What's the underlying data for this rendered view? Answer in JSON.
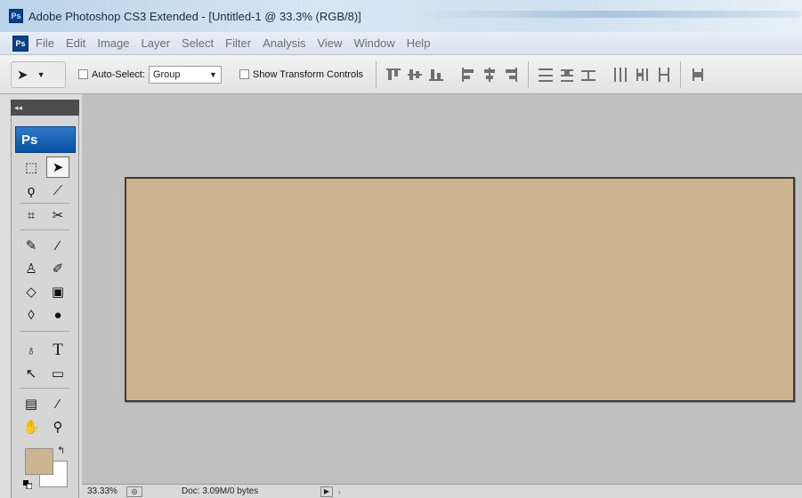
{
  "window": {
    "app_badge": "Ps",
    "title": "Adobe Photoshop CS3 Extended - [Untitled-1 @ 33.3% (RGB/8)]"
  },
  "menu": {
    "badge": "Ps",
    "items": [
      "File",
      "Edit",
      "Image",
      "Layer",
      "Select",
      "Filter",
      "Analysis",
      "View",
      "Window",
      "Help"
    ]
  },
  "options": {
    "tool_preset_icon": "move-tool-icon",
    "auto_select_label": "Auto-Select:",
    "auto_select_checked": false,
    "auto_select_value": "Group",
    "show_transform_label": "Show Transform Controls",
    "show_transform_checked": false
  },
  "toolbox": {
    "collapse_glyph": "◂◂",
    "logo": "Ps",
    "tools": [
      "rectangular-marquee-tool",
      "move-tool",
      "lasso-tool",
      "magic-wand-tool",
      "crop-tool",
      "slice-tool",
      "healing-brush-tool",
      "brush-tool",
      "clone-stamp-tool",
      "history-brush-tool",
      "eraser-tool",
      "gradient-tool",
      "blur-tool",
      "dodge-tool",
      "pen-tool",
      "type-tool",
      "path-selection-tool",
      "rectangle-tool",
      "notes-tool",
      "eyedropper-tool",
      "hand-tool",
      "zoom-tool"
    ],
    "selected_tool": "move-tool",
    "foreground_color": "#cdb490",
    "background_color": "#ffffff"
  },
  "document": {
    "fill_color": "#cdb490"
  },
  "status": {
    "zoom": "33.33%",
    "doc_info": "Doc: 3.09M/0 bytes"
  }
}
